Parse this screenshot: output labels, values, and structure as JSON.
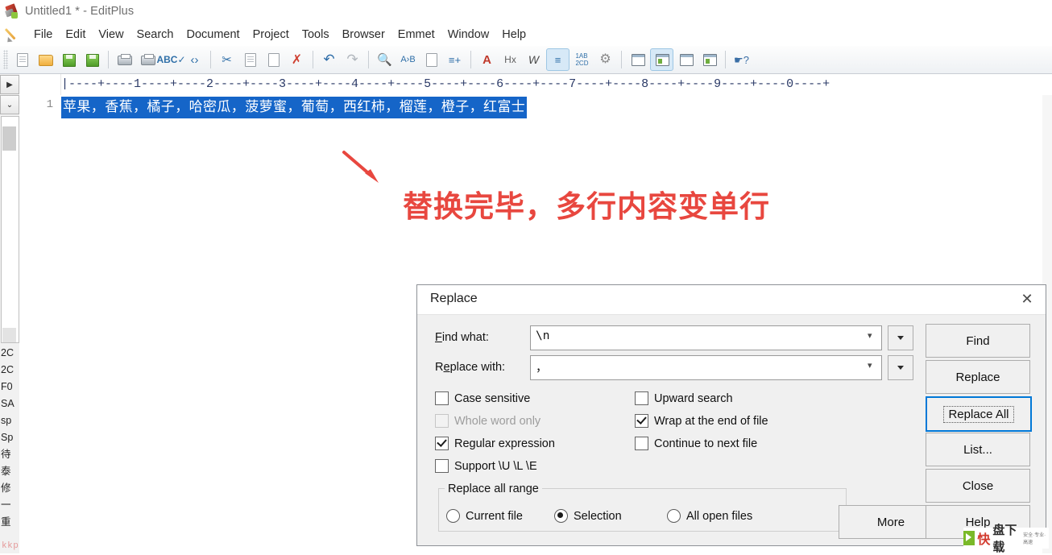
{
  "window": {
    "title": "Untitled1 * - EditPlus",
    "app_icon": "editplus-icon"
  },
  "menubar": {
    "leading_icon": "pencil-icon",
    "items": [
      {
        "label": "File"
      },
      {
        "label": "Edit"
      },
      {
        "label": "View"
      },
      {
        "label": "Search"
      },
      {
        "label": "Document"
      },
      {
        "label": "Project"
      },
      {
        "label": "Tools"
      },
      {
        "label": "Browser"
      },
      {
        "label": "Emmet"
      },
      {
        "label": "Window"
      },
      {
        "label": "Help"
      }
    ]
  },
  "toolbar": {
    "buttons": [
      {
        "name": "new-document-icon",
        "glyph": ""
      },
      {
        "name": "open-file-icon",
        "glyph": ""
      },
      {
        "name": "save-icon",
        "glyph": ""
      },
      {
        "name": "save-all-icon",
        "glyph": ""
      },
      {
        "name": "print-preview-icon",
        "glyph": ""
      },
      {
        "name": "print-icon",
        "glyph": ""
      },
      {
        "name": "spell-check-icon",
        "glyph": "ABC"
      },
      {
        "name": "view-in-browser-icon",
        "glyph": "<>"
      },
      {
        "name": "cut-icon",
        "glyph": "✂"
      },
      {
        "name": "copy-icon",
        "glyph": ""
      },
      {
        "name": "paste-icon",
        "glyph": ""
      },
      {
        "name": "delete-icon",
        "glyph": "✕"
      },
      {
        "name": "undo-icon",
        "glyph": "↶"
      },
      {
        "name": "redo-icon",
        "glyph": "↷"
      },
      {
        "name": "find-icon",
        "glyph": "⚲"
      },
      {
        "name": "replace-icon",
        "glyph": "A→B"
      },
      {
        "name": "find-next-icon",
        "glyph": ""
      },
      {
        "name": "goto-line-icon",
        "glyph": ""
      },
      {
        "name": "format-icon",
        "glyph": "A"
      },
      {
        "name": "hex-view-icon",
        "glyph": "Hx"
      },
      {
        "name": "word-wrap-icon",
        "glyph": "W"
      },
      {
        "name": "indent-icon",
        "glyph": ""
      },
      {
        "name": "toggle-case-icon",
        "glyph": "1AB\n2CD"
      },
      {
        "name": "preferences-icon",
        "glyph": "⚙"
      },
      {
        "name": "document-selector-icon",
        "glyph": ""
      },
      {
        "name": "directory-window-icon",
        "glyph": ""
      },
      {
        "name": "cliptext-window-icon",
        "glyph": ""
      },
      {
        "name": "output-window-icon",
        "glyph": ""
      },
      {
        "name": "context-help-icon",
        "glyph": "?"
      }
    ]
  },
  "left_dock": {
    "collapse_button": "▶",
    "expand_button": "⌄",
    "list_items": [
      "2C",
      "2C",
      "F0",
      "SA",
      "sp",
      "Sp",
      "待",
      "泰",
      "修",
      "一",
      "重"
    ]
  },
  "ruler": {
    "marks": "|----+----1----+----2----+----3----+----4----+----5----+----6----+----7----+----8----+----9----+----0----+"
  },
  "editor": {
    "line_number": "1",
    "line_text": "苹果，香蕉，橘子，哈密瓜，菠萝蜜，葡萄，西红柿，榴莲，橙子，红富士",
    "selection_color": "#1565c8",
    "selection_text_color": "#ffffff"
  },
  "annotation": {
    "text": "替换完毕，多行内容变单行",
    "color": "#e8473f",
    "arrow": "down-right-arrow-icon"
  },
  "dialog": {
    "title": "Replace",
    "close_label": "✕",
    "find_label": "Find what:",
    "find_value": "\\n",
    "replace_label": "Replace with:",
    "replace_value": "，",
    "checkboxes": [
      {
        "label": "Case sensitive",
        "checked": false,
        "disabled": false,
        "name": "case-sensitive-checkbox"
      },
      {
        "label": "Whole word only",
        "checked": false,
        "disabled": true,
        "name": "whole-word-only-checkbox"
      },
      {
        "label": "Regular expression",
        "checked": true,
        "disabled": false,
        "name": "regular-expression-checkbox"
      },
      {
        "label": "Support \\U \\L \\E",
        "checked": false,
        "disabled": false,
        "name": "support-case-escape-checkbox"
      },
      {
        "label": "Upward search",
        "checked": false,
        "disabled": false,
        "name": "upward-search-checkbox"
      },
      {
        "label": "Wrap at the end of file",
        "checked": true,
        "disabled": false,
        "name": "wrap-at-end-of-file-checkbox"
      },
      {
        "label": "Continue to next file",
        "checked": false,
        "disabled": false,
        "name": "continue-to-next-file-checkbox"
      }
    ],
    "range_group": {
      "title": "Replace all range",
      "options": [
        {
          "label": "Current file",
          "selected": false
        },
        {
          "label": "Selection",
          "selected": true
        },
        {
          "label": "All open files",
          "selected": false
        }
      ]
    },
    "buttons": [
      {
        "label": "Find",
        "focused": false,
        "name": "find-button"
      },
      {
        "label": "Replace",
        "focused": false,
        "name": "replace-button"
      },
      {
        "label": "Replace All",
        "focused": true,
        "name": "replace-all-button"
      },
      {
        "label": "List...",
        "focused": false,
        "name": "list-button"
      },
      {
        "label": "Close",
        "focused": false,
        "name": "close-button"
      },
      {
        "label": "More",
        "focused": false,
        "name": "more-button"
      },
      {
        "label": "Help",
        "focused": false,
        "name": "help-button"
      }
    ],
    "accent_color": "#0078d7"
  },
  "watermarks": {
    "bottom_left": "kkpan.com",
    "bottom_right_primary": "快",
    "bottom_right_secondary": "盘下载",
    "bottom_right_tagline": "安全·专业·高速"
  }
}
